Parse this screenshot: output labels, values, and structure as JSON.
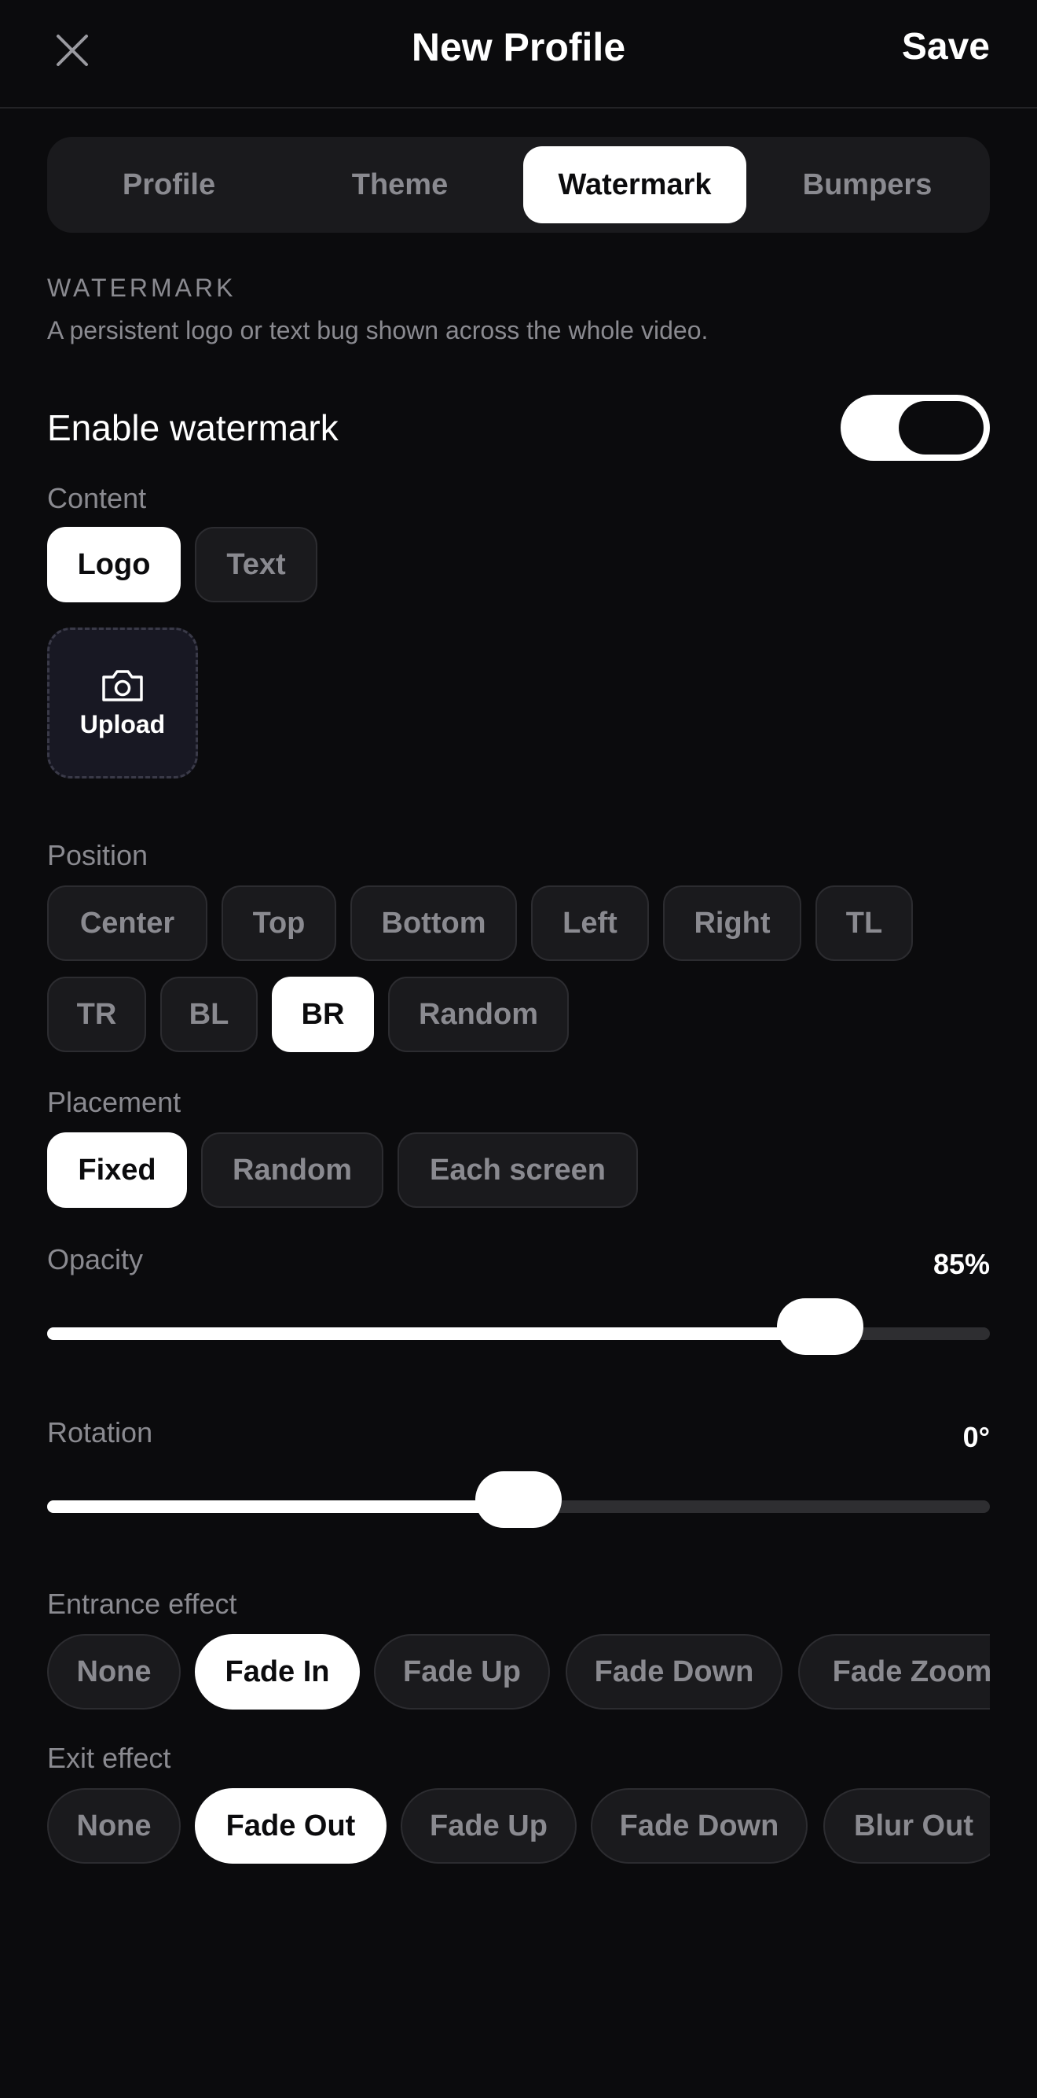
{
  "header": {
    "title": "New Profile",
    "save_label": "Save",
    "close_icon": "close-icon"
  },
  "tabs": [
    {
      "label": "Profile",
      "active": false
    },
    {
      "label": "Theme",
      "active": false
    },
    {
      "label": "Watermark",
      "active": true
    },
    {
      "label": "Bumpers",
      "active": false
    }
  ],
  "watermark": {
    "section_title": "WATERMARK",
    "description": "A persistent logo or text bug shown across the whole video.",
    "enable_label": "Enable watermark",
    "enabled": true
  },
  "content": {
    "label": "Content",
    "options": [
      {
        "label": "Logo",
        "active": true
      },
      {
        "label": "Text",
        "active": false
      }
    ],
    "upload_label": "Upload",
    "upload_icon": "camera-icon"
  },
  "position": {
    "label": "Position",
    "options": [
      {
        "label": "Center",
        "active": false
      },
      {
        "label": "Top",
        "active": false
      },
      {
        "label": "Bottom",
        "active": false
      },
      {
        "label": "Left",
        "active": false
      },
      {
        "label": "Right",
        "active": false
      },
      {
        "label": "TL",
        "active": false
      },
      {
        "label": "TR",
        "active": false
      },
      {
        "label": "BL",
        "active": false
      },
      {
        "label": "BR",
        "active": true
      },
      {
        "label": "Random",
        "active": false
      }
    ]
  },
  "placement": {
    "label": "Placement",
    "options": [
      {
        "label": "Fixed",
        "active": true
      },
      {
        "label": "Random",
        "active": false
      },
      {
        "label": "Each screen",
        "active": false
      }
    ]
  },
  "opacity": {
    "label": "Opacity",
    "value_text": "85%",
    "fraction": 0.82
  },
  "rotation": {
    "label": "Rotation",
    "value_text": "0°",
    "fraction": 0.5
  },
  "entrance": {
    "label": "Entrance effect",
    "options": [
      {
        "label": "None",
        "active": false
      },
      {
        "label": "Fade In",
        "active": true
      },
      {
        "label": "Fade Up",
        "active": false
      },
      {
        "label": "Fade Down",
        "active": false
      },
      {
        "label": "Fade Zoom",
        "active": false
      }
    ]
  },
  "exit": {
    "label": "Exit effect",
    "options": [
      {
        "label": "None",
        "active": false
      },
      {
        "label": "Fade Out",
        "active": true
      },
      {
        "label": "Fade Up",
        "active": false
      },
      {
        "label": "Fade Down",
        "active": false
      },
      {
        "label": "Blur Out",
        "active": false
      }
    ]
  },
  "colors": {
    "background": "#0b0b0d",
    "surface": "#1a1a1d",
    "accent": "#ffffff",
    "muted_text": "#8a8a90"
  }
}
